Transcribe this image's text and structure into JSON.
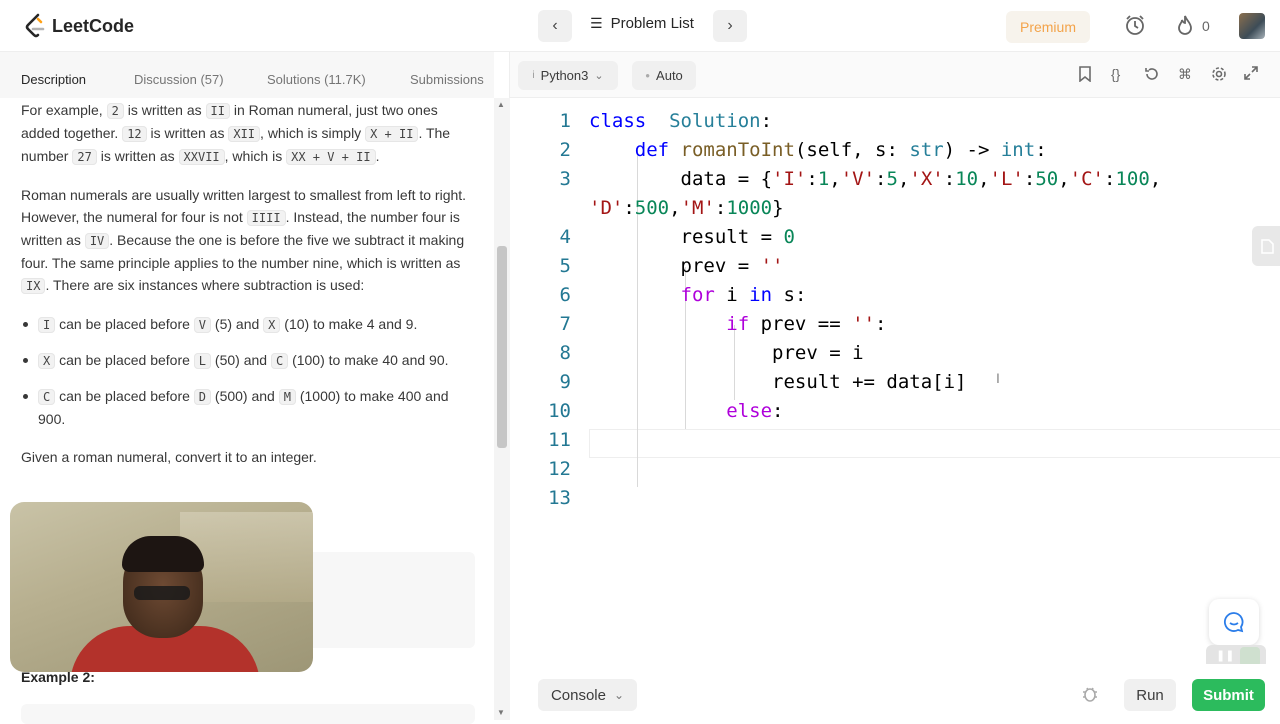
{
  "header": {
    "logo_text": "LeetCode",
    "problem_list_label": "Problem List",
    "premium_label": "Premium",
    "streak_count": "0"
  },
  "tabs": [
    "Description",
    "Discussion (57)",
    "Solutions (11.7K)",
    "Submissions"
  ],
  "description": {
    "p1": [
      {
        "t": "For example, "
      },
      {
        "c": "2"
      },
      {
        "t": " is written as "
      },
      {
        "c": "II"
      },
      {
        "t": " in Roman numeral, just two ones added together. "
      },
      {
        "c": "12"
      },
      {
        "t": " is written as "
      },
      {
        "c": "XII"
      },
      {
        "t": ", which is simply "
      },
      {
        "c": "X + II"
      },
      {
        "t": ". The number "
      },
      {
        "c": "27"
      },
      {
        "t": " is written as "
      },
      {
        "c": "XXVII"
      },
      {
        "t": ", which is "
      },
      {
        "c": "XX + V + II"
      },
      {
        "t": "."
      }
    ],
    "p2": [
      {
        "t": "Roman numerals are usually written largest to smallest from left to right. However, the numeral for four is not "
      },
      {
        "c": "IIII"
      },
      {
        "t": ". Instead, the number four is written as "
      },
      {
        "c": "IV"
      },
      {
        "t": ". Because the one is before the five we subtract it making four. The same principle applies to the number nine, which is written as "
      },
      {
        "c": "IX"
      },
      {
        "t": ". There are six instances where subtraction is used:"
      }
    ],
    "bullets": [
      [
        {
          "c": "I"
        },
        {
          "t": " can be placed before "
        },
        {
          "c": "V"
        },
        {
          "t": " (5) and "
        },
        {
          "c": "X"
        },
        {
          "t": " (10) to make 4 and 9."
        }
      ],
      [
        {
          "c": "X"
        },
        {
          "t": " can be placed before "
        },
        {
          "c": "L"
        },
        {
          "t": " (50) and "
        },
        {
          "c": "C"
        },
        {
          "t": " (100) to make 40 and 90."
        }
      ],
      [
        {
          "c": "C"
        },
        {
          "t": " can be placed before "
        },
        {
          "c": "D"
        },
        {
          "t": " (500) and "
        },
        {
          "c": "M"
        },
        {
          "t": " (1000) to make 400 and 900."
        }
      ]
    ],
    "p3": "Given a roman numeral, convert it to an integer.",
    "example2": "Example 2:"
  },
  "editor": {
    "language": "Python3",
    "mode": "Auto",
    "line_numbers": [
      "1",
      "2",
      "3",
      "",
      "4",
      "5",
      "6",
      "7",
      "8",
      "9",
      "10",
      "11",
      "12",
      "13"
    ],
    "lines": [
      [
        [
          "kw",
          "class"
        ],
        [
          "",
          "  "
        ],
        [
          "cls",
          "Solution"
        ],
        [
          "",
          ":"
        ]
      ],
      [
        [
          "",
          "    "
        ],
        [
          "kw",
          "def"
        ],
        [
          "",
          " "
        ],
        [
          "fn",
          "romanToInt"
        ],
        [
          "",
          "(self, s: "
        ],
        [
          "cls",
          "str"
        ],
        [
          "",
          ") -> "
        ],
        [
          "cls",
          "int"
        ],
        [
          "",
          ":"
        ]
      ],
      [
        [
          "",
          "        data = {"
        ],
        [
          "str",
          "'I'"
        ],
        [
          "",
          ":"
        ],
        [
          "num",
          "1"
        ],
        [
          "",
          ","
        ],
        [
          "str",
          "'V'"
        ],
        [
          "",
          ":"
        ],
        [
          "num",
          "5"
        ],
        [
          "",
          ","
        ],
        [
          "str",
          "'X'"
        ],
        [
          "",
          ":"
        ],
        [
          "num",
          "10"
        ],
        [
          "",
          ","
        ],
        [
          "str",
          "'L'"
        ],
        [
          "",
          ":"
        ],
        [
          "num",
          "50"
        ],
        [
          "",
          ","
        ],
        [
          "str",
          "'C'"
        ],
        [
          "",
          ":"
        ],
        [
          "num",
          "100"
        ],
        [
          "",
          ","
        ]
      ],
      [
        [
          "str",
          "'D'"
        ],
        [
          "",
          ":"
        ],
        [
          "num",
          "500"
        ],
        [
          "",
          ","
        ],
        [
          "str",
          "'M'"
        ],
        [
          "",
          ":"
        ],
        [
          "num",
          "1000"
        ],
        [
          "",
          "}"
        ]
      ],
      [
        [
          "",
          "        result = "
        ],
        [
          "num",
          "0"
        ]
      ],
      [
        [
          "",
          "        prev = "
        ],
        [
          "str",
          "''"
        ]
      ],
      [
        [
          "",
          "        "
        ],
        [
          "kw2",
          "for"
        ],
        [
          "",
          " i "
        ],
        [
          "kw",
          "in"
        ],
        [
          "",
          " s:"
        ]
      ],
      [
        [
          "",
          "            "
        ],
        [
          "kw2",
          "if"
        ],
        [
          "",
          " prev == "
        ],
        [
          "str",
          "''"
        ],
        [
          "",
          ":"
        ]
      ],
      [
        [
          "",
          "                prev = i"
        ]
      ],
      [
        [
          "",
          "                result += data[i]"
        ]
      ],
      [
        [
          "",
          "            "
        ],
        [
          "kw2",
          "else"
        ],
        [
          "",
          ":"
        ]
      ],
      [
        [
          "",
          ""
        ]
      ],
      [
        [
          "",
          ""
        ]
      ],
      [
        [
          "",
          ""
        ]
      ]
    ]
  },
  "bottom": {
    "console_label": "Console",
    "run_label": "Run",
    "submit_label": "Submit"
  },
  "colors": {
    "submit": "#2cbb5d",
    "premium": "#f3a34a"
  }
}
